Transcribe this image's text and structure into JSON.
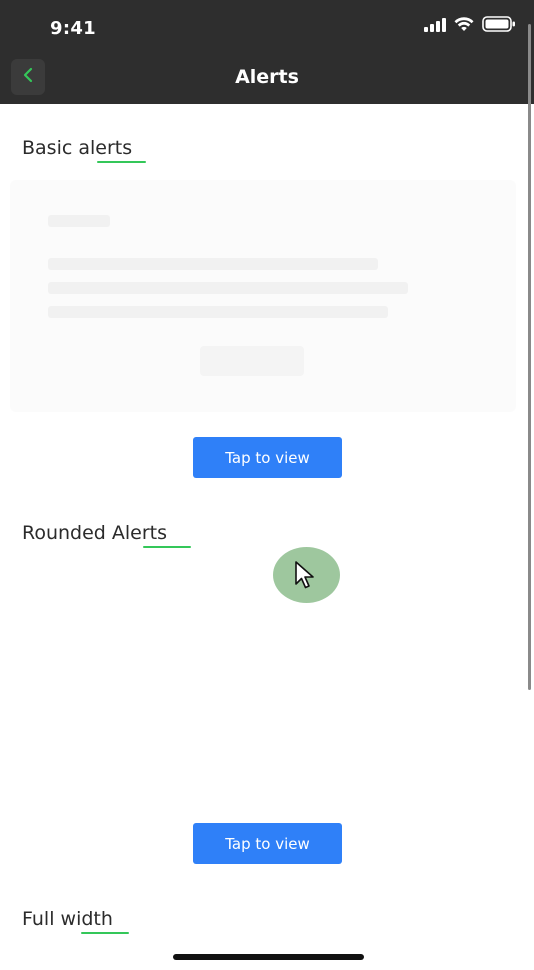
{
  "status_bar": {
    "time": "9:41",
    "icons": [
      "cellular-signal-icon",
      "wifi-icon",
      "battery-icon"
    ]
  },
  "nav": {
    "title": "Alerts",
    "back_icon": "chevron-left-icon"
  },
  "sections": [
    {
      "title": "Basic alerts",
      "button_label": "Tap to view"
    },
    {
      "title": "Rounded Alerts",
      "button_label": "Tap to view"
    },
    {
      "title": "Full width"
    }
  ],
  "colors": {
    "topbar": "#2e2e2e",
    "accent_green": "#34c759",
    "button_blue": "#2f80f8",
    "touch_indicator": "#7db47d"
  }
}
